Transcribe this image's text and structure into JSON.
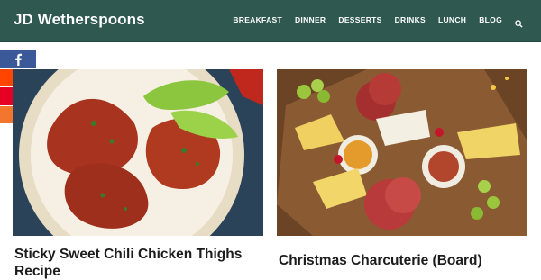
{
  "header": {
    "brand": "JD Wetherspoons",
    "nav": [
      "BREAKFAST",
      "DINNER",
      "DESSERTS",
      "DRINKS",
      "LUNCH",
      "BLOG"
    ],
    "search_icon": "search-icon"
  },
  "share": {
    "icons": [
      "facebook-icon",
      "reddit-icon",
      "pinterest-icon",
      "more-share-icon"
    ]
  },
  "cards": [
    {
      "title": "Sticky Sweet Chili Chicken Thighs Recipe"
    },
    {
      "title": "Christmas Charcuterie (Board)"
    }
  ],
  "colors": {
    "header_bg": "#2e5850",
    "facebook": "#3b5998",
    "reddit": "#ff4500",
    "pinterest": "#e60023",
    "more": "#f2762e"
  }
}
